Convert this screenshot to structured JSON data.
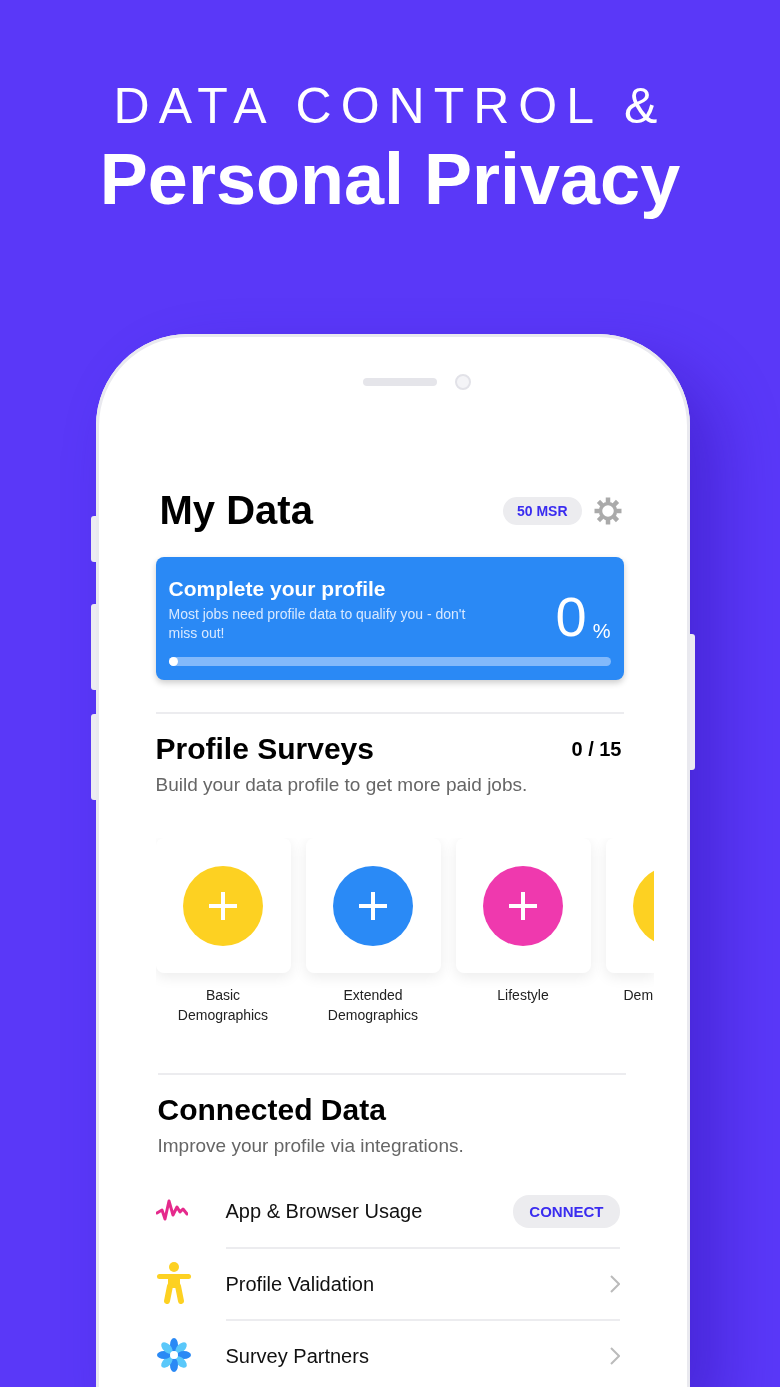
{
  "headline": {
    "top": "DATA CONTROL &",
    "bottom": "Personal Privacy"
  },
  "header": {
    "title": "My Data",
    "balance": "50 MSR"
  },
  "profile_card": {
    "title": "Complete your profile",
    "text": "Most jobs need profile data to qualify you - don't miss out!",
    "percent": "0",
    "unit": "%",
    "level": 0
  },
  "surveys": {
    "title": "Profile Surveys",
    "count": "0 / 15",
    "subtitle": "Build your data profile to get more paid jobs.",
    "items": [
      {
        "label": "Basic Demographics",
        "color": "#fdd122",
        "clipped": false
      },
      {
        "label": "Extended Demographics",
        "color": "#2a8af6",
        "clipped": false
      },
      {
        "label": "Lifestyle",
        "color": "#ef39ae",
        "clipped": false
      },
      {
        "label": "Dem",
        "color": "#fdd122",
        "clipped": true
      }
    ]
  },
  "connected": {
    "title": "Connected Data",
    "subtitle": "Improve your profile via integrations.",
    "items": [
      {
        "kind": "activity",
        "label": "App & Browser Usage",
        "action": "CONNECT"
      },
      {
        "kind": "person",
        "label": "Profile Validation"
      },
      {
        "kind": "flower",
        "label": "Survey Partners"
      }
    ]
  }
}
